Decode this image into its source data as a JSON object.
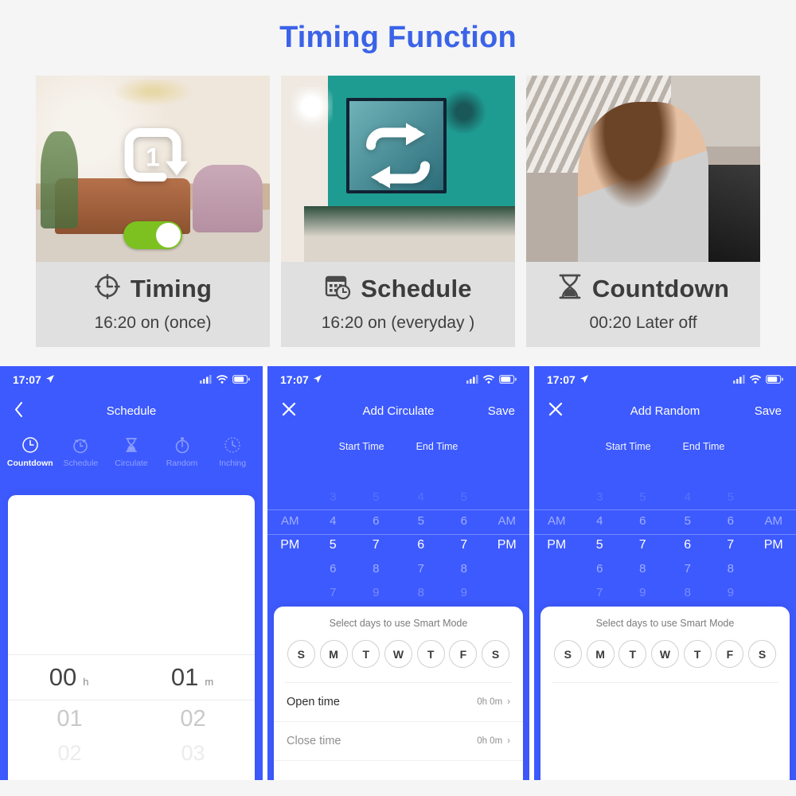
{
  "header": {
    "title": "Timing Function",
    "accent_color": "#3b63e8"
  },
  "feature_cards": [
    {
      "icon": "repeat-once-icon",
      "title": "Timing",
      "subtitle": "16:20 on (once)",
      "title_icon": "clock-timer-icon",
      "toggle_state": "on",
      "toggle_color": "#7cc120"
    },
    {
      "icon": "repeat-cycle-icon",
      "title": "Schedule",
      "subtitle": "16:20 on (everyday )",
      "title_icon": "calendar-clock-icon",
      "toggle_state": "on",
      "toggle_color": "#7cc120"
    },
    {
      "icon": "none",
      "title": "Countdown",
      "subtitle": "00:20 Later off",
      "title_icon": "hourglass-icon",
      "toggle_state": "off",
      "toggle_color": "#8d8d8d"
    }
  ],
  "phones": [
    {
      "status": {
        "time": "17:07",
        "location_icon": "location-arrow-icon",
        "signal_icon": "signal-bars-icon",
        "wifi_icon": "wifi-icon",
        "battery_icon": "battery-icon"
      },
      "nav": {
        "left": "‹",
        "left_icon": "back-chevron-icon",
        "title": "Schedule",
        "right": ""
      },
      "tabs": [
        {
          "label": "Countdown",
          "icon": "clock-icon",
          "active": true
        },
        {
          "label": "Schedule",
          "icon": "alarm-clock-icon",
          "active": false
        },
        {
          "label": "Circulate",
          "icon": "hourglass-icon",
          "active": false
        },
        {
          "label": "Random",
          "icon": "stopwatch-icon",
          "active": false
        },
        {
          "label": "Inching",
          "icon": "clock-hand-icon",
          "active": false
        }
      ],
      "duration_picker": {
        "selected": [
          {
            "value": "00",
            "unit": "h"
          },
          {
            "value": "01",
            "unit": "m"
          }
        ],
        "next_row": [
          "01",
          "02"
        ],
        "next_row2": [
          "02",
          "03"
        ]
      }
    },
    {
      "status": {
        "time": "17:07",
        "location_icon": "location-arrow-icon",
        "signal_icon": "signal-bars-icon",
        "wifi_icon": "wifi-icon",
        "battery_icon": "battery-icon"
      },
      "nav": {
        "left": "✕",
        "left_icon": "close-icon",
        "title": "Add Circulate",
        "right": "Save"
      },
      "picker_headers": {
        "start": "Start Time",
        "end": "End Time"
      },
      "start_picker": {
        "meridiem": {
          "above": "AM",
          "selected": "PM"
        },
        "hour": {
          "above2": "3",
          "above1": "4",
          "selected": "5",
          "below1": "6",
          "below2": "7"
        },
        "minute": {
          "above2": "5",
          "above1": "6",
          "selected": "7",
          "below1": "8",
          "below2": "9"
        }
      },
      "end_picker": {
        "hour": {
          "above2": "4",
          "above1": "5",
          "selected": "6",
          "below1": "7",
          "below2": "8"
        },
        "minute": {
          "above2": "5",
          "above1": "6",
          "selected": "7",
          "below1": "8",
          "below2": "9"
        },
        "meridiem": {
          "above": "AM",
          "selected": "PM"
        }
      },
      "sheet": {
        "title": "Select days to use Smart Mode",
        "days": [
          "S",
          "M",
          "T",
          "W",
          "T",
          "F",
          "S"
        ],
        "rows": [
          {
            "label": "Open time",
            "value": "0h 0m",
            "chevron": "›",
            "dim": false
          },
          {
            "label": "Close time",
            "value": "0h 0m",
            "chevron": "›",
            "dim": true
          }
        ]
      }
    },
    {
      "status": {
        "time": "17:07",
        "location_icon": "location-arrow-icon",
        "signal_icon": "signal-bars-icon",
        "wifi_icon": "wifi-icon",
        "battery_icon": "battery-icon"
      },
      "nav": {
        "left": "✕",
        "left_icon": "close-icon",
        "title": "Add Random",
        "right": "Save"
      },
      "picker_headers": {
        "start": "Start Time",
        "end": "End Time"
      },
      "start_picker": {
        "meridiem": {
          "above": "AM",
          "selected": "PM"
        },
        "hour": {
          "above2": "3",
          "above1": "4",
          "selected": "5",
          "below1": "6",
          "below2": "7"
        },
        "minute": {
          "above2": "5",
          "above1": "6",
          "selected": "7",
          "below1": "8",
          "below2": "9"
        }
      },
      "end_picker": {
        "hour": {
          "above2": "4",
          "above1": "5",
          "selected": "6",
          "below1": "7",
          "below2": "8"
        },
        "minute": {
          "above2": "5",
          "above1": "6",
          "selected": "7",
          "below1": "8",
          "below2": "9"
        },
        "meridiem": {
          "above": "AM",
          "selected": "PM"
        }
      },
      "sheet": {
        "title": "Select days to use Smart Mode",
        "days": [
          "S",
          "M",
          "T",
          "W",
          "T",
          "F",
          "S"
        ],
        "rows": []
      }
    }
  ],
  "colors": {
    "phone_blue": "#3d5afe",
    "page_bg": "#f5f5f5",
    "card_bg": "#e0e0e0"
  }
}
